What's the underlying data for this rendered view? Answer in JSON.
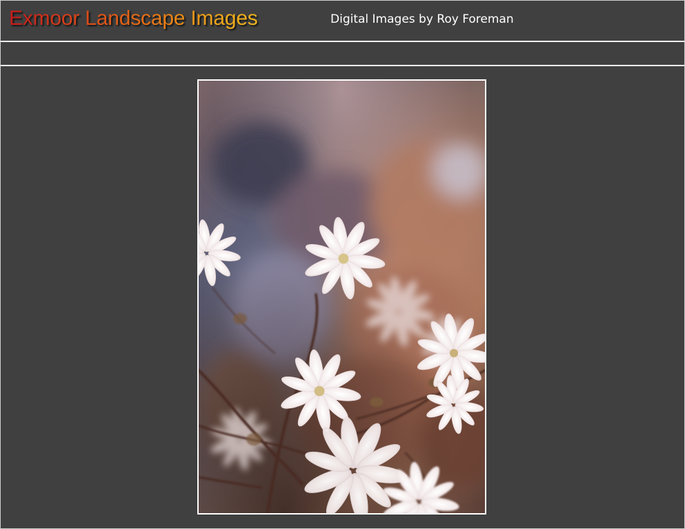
{
  "header": {
    "title": "Exmoor Landscape Images",
    "subtitle": "Digital Images by Roy Foreman"
  },
  "colors": {
    "background": "#404040",
    "rule": "#f2f2f2",
    "title_gradient_start": "#c21a1a",
    "title_gradient_end": "#f0b51e",
    "subtitle": "#ffffff",
    "photo_border": "#ffffff"
  },
  "main": {
    "photo": {
      "subject": "white star magnolia blossoms"
    }
  }
}
